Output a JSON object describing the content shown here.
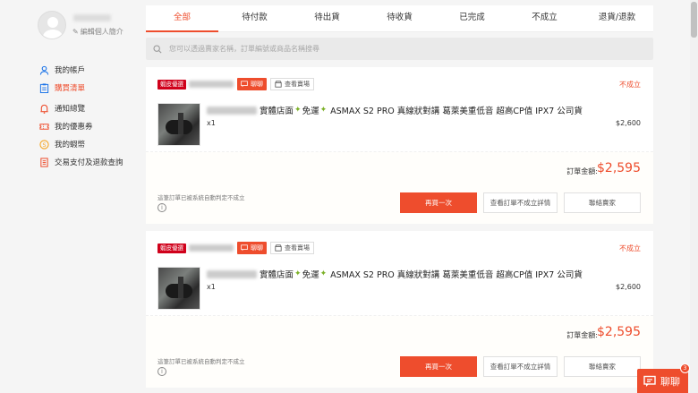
{
  "sidebar": {
    "edit_profile": "編輯個人簡介",
    "items": [
      {
        "label": "我的帳戶",
        "icon": "user-icon"
      },
      {
        "label": "購買清單",
        "icon": "clipboard-icon"
      },
      {
        "label": "通知總覽",
        "icon": "bell-icon"
      },
      {
        "label": "我的優惠券",
        "icon": "ticket-icon"
      },
      {
        "label": "我的蝦幣",
        "icon": "coin-icon"
      },
      {
        "label": "交易支付及退款查詢",
        "icon": "document-icon"
      }
    ]
  },
  "tabs": [
    "全部",
    "待付款",
    "待出貨",
    "待收貨",
    "已完成",
    "不成立",
    "退貨/退款"
  ],
  "search": {
    "placeholder": "您可以透過賣家名稱，訂單編號或商品名稱搜尋"
  },
  "orders": [
    {
      "badge": "蝦皮優選",
      "chat_label": "聊聊",
      "shop_label": "查看賣場",
      "status": "不成立",
      "item_title_1": "實體店面",
      "item_title_2": "免運",
      "item_title_3": "ASMAX S2 PRO 真線狀對講 葛萊美重低音 超高CP值 IPX7 公司貨",
      "qty": "x1",
      "price": "$2,600",
      "total_label": "訂單金額:",
      "total": "$2,595",
      "note": "這筆訂單已被系統自動判定不成立",
      "buy_again": "再買一次",
      "view_detail": "查看訂單不成立詳情",
      "contact_seller": "聯絡賣家"
    },
    {
      "badge": "蝦皮優選",
      "chat_label": "聊聊",
      "shop_label": "查看賣場",
      "status": "不成立",
      "item_title_1": "實體店面",
      "item_title_2": "免運",
      "item_title_3": "ASMAX S2 PRO 真線狀對講 葛萊美重低音 超高CP值 IPX7 公司貨",
      "qty": "x1",
      "price": "$2,600",
      "total_label": "訂單金額:",
      "total": "$2,595",
      "note": "這筆訂單已被系統自動判定不成立",
      "buy_again": "再買一次",
      "view_detail": "查看訂單不成立詳情",
      "contact_seller": "聯絡賣家"
    }
  ],
  "chat_float": {
    "label": "聊聊",
    "count": "3"
  },
  "colors": {
    "accent": "#ee4d2d",
    "badge": "#d0011b",
    "star": "#7bb026"
  }
}
